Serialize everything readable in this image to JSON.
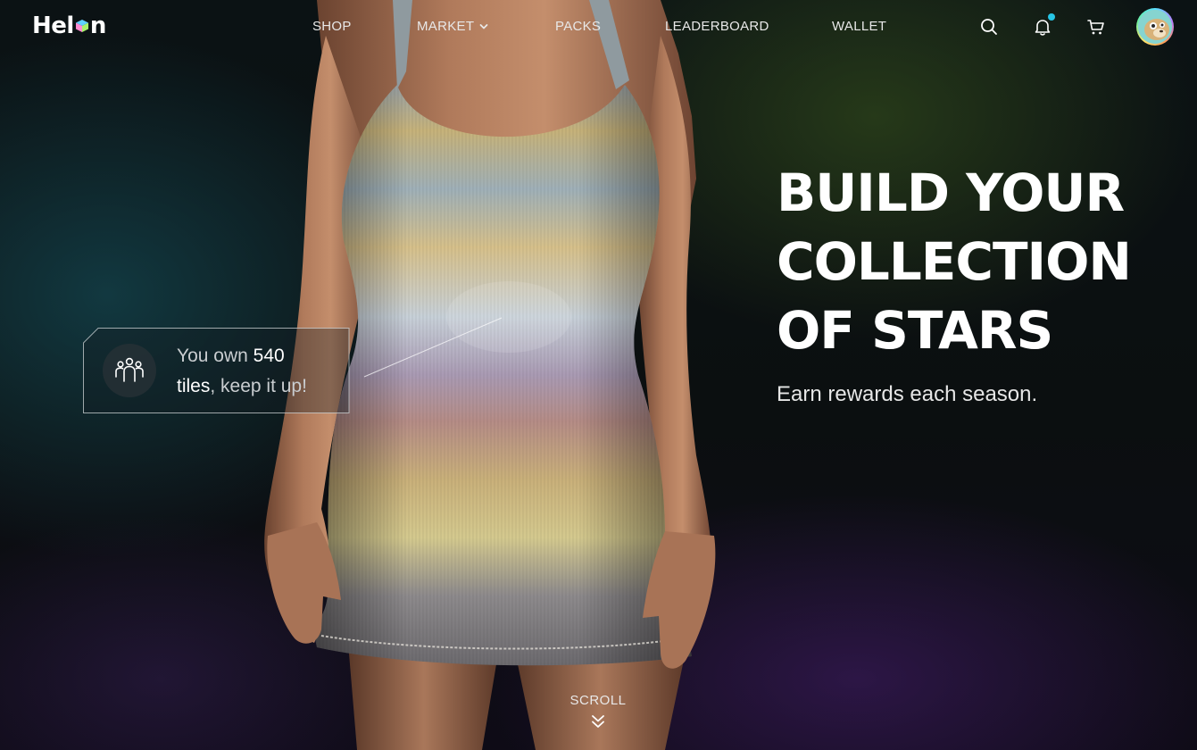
{
  "brand": {
    "name_prefix": "Hel",
    "name_suffix": "n"
  },
  "nav": {
    "items": [
      {
        "label": "SHOP"
      },
      {
        "label": "MARKET",
        "has_dropdown": true
      },
      {
        "label": "PACKS"
      },
      {
        "label": "LEADERBOARD"
      },
      {
        "label": "WALLET"
      }
    ]
  },
  "header_icons": {
    "search": "search-icon",
    "notifications": "bell-icon",
    "notifications_unread": true,
    "cart": "cart-icon",
    "avatar": "user-avatar"
  },
  "hero": {
    "title_lines": [
      "BUILD YOUR",
      "COLLECTION",
      "OF STARS"
    ],
    "subtitle": "Earn rewards each season."
  },
  "callout": {
    "icon": "community-icon",
    "text_before": "You own ",
    "highlight_number": "540",
    "highlight_word": "tiles",
    "text_after": ", keep it up!"
  },
  "scroll": {
    "label": "SCROLL",
    "icon": "double-chevron-down-icon"
  },
  "colors": {
    "accent_cyan": "#27c6e6",
    "text_primary": "#ffffff",
    "text_muted": "#c9cdd0",
    "background": "#0a0d0f"
  }
}
